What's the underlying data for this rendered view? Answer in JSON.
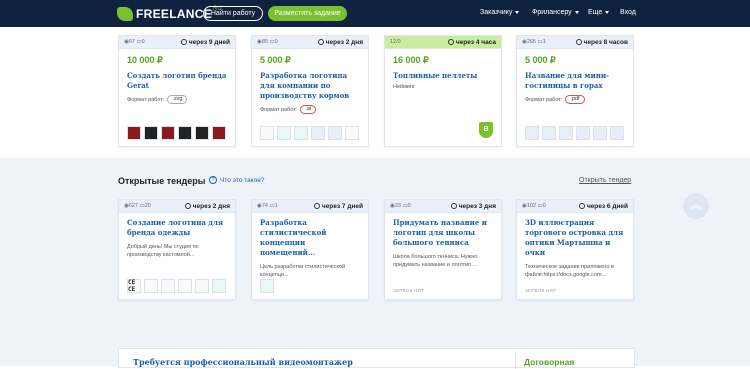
{
  "header": {
    "logo": "FREELANCE",
    "logo_suffix": "RU",
    "find_work": "Найти работу",
    "post_task": "Разместить задание",
    "nav": [
      {
        "label": "Заказчику"
      },
      {
        "label": "Фрилансеру"
      },
      {
        "label": "Еще"
      }
    ],
    "login": "Вход"
  },
  "contests": [
    {
      "views": "67",
      "comments": "0",
      "deadline": "через 9 дней",
      "price": "10 000 ₽",
      "title": "Создать логотип бренда Gerat",
      "format_label": "Формат работ:",
      "format": ".svg"
    },
    {
      "views": "85",
      "comments": "0",
      "deadline": "через 2 дня",
      "price": "5 000 ₽",
      "title": "Разработка логотипа для компании по производству кормов",
      "format_label": "Формат работ:",
      "format": ".ai"
    },
    {
      "views": "12/0",
      "deadline": "через 4 часа",
      "price": "16 000 ₽",
      "title": "Топливные пеллеты",
      "subtitle": "Нейминг",
      "badge": "B"
    },
    {
      "views": "265",
      "comments": "1",
      "deadline": "через 8 часов",
      "price": "5 000 ₽",
      "title": "Название для мини-гостиницы в горах",
      "format_label": "Формат работ:",
      "format": ".pdf"
    }
  ],
  "tenders_section": {
    "title": "Открытые тендеры",
    "what_is_it": "Что это такое?",
    "open_tender": "Открыть тендер"
  },
  "tenders": [
    {
      "views": "627",
      "comments": "20",
      "deadline": "через 2 дня",
      "title": "Создание логотипа для бренда одежды",
      "desc": "Добрый день! Мы студия по производству кастомной...",
      "stamp": "CE CE"
    },
    {
      "views": "74",
      "comments": "1",
      "deadline": "через 7 дней",
      "title": "Разработка стилистической концепции помещений...",
      "desc": "Цель разработки стилистической концепци..."
    },
    {
      "views": "23",
      "comments": "0",
      "deadline": "через 3 дня",
      "title": "Придумать название и логотип для школы большого тенниса",
      "desc": "Школа большого тенниса. Нужно придумать название и логотип ...",
      "hidden": "ЗЕРБОК НЯТ"
    },
    {
      "views": "102",
      "comments": "0",
      "deadline": "через 6 дней",
      "title": "3D иллюстрация торгового островка для оптики Мартышна и очки",
      "desc": "Техническое задание приложено в файле:https://docs.google.com...",
      "hidden": "ЗЕРБОК НЯТ"
    }
  ],
  "job": {
    "title": "Требуется профессиональный видеомонтажер",
    "price": "Договорная"
  },
  "colors": {
    "header_bg": "#0f2341",
    "accent_green": "#79c22e",
    "link_blue": "#1a5fa8",
    "section_bg": "#eef3fa"
  }
}
